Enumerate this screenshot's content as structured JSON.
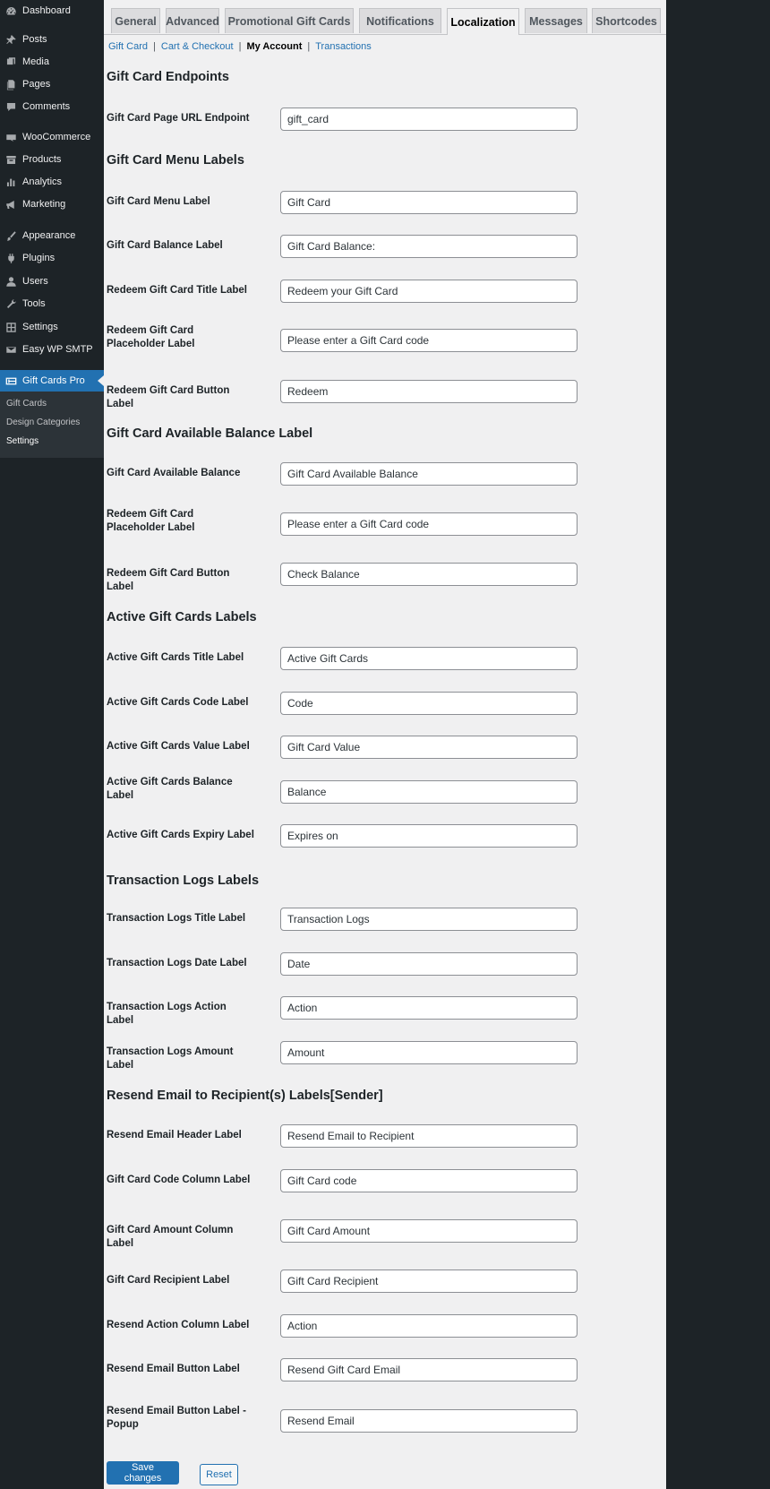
{
  "sidebar": {
    "items": [
      {
        "label": "Dashboard",
        "icon": "dashboard-icon"
      },
      {
        "label": "Posts",
        "icon": "pin-icon"
      },
      {
        "label": "Media",
        "icon": "media-icon"
      },
      {
        "label": "Pages",
        "icon": "pages-icon"
      },
      {
        "label": "Comments",
        "icon": "comment-icon"
      },
      {
        "label": "WooCommerce",
        "icon": "woo-icon"
      },
      {
        "label": "Products",
        "icon": "archive-icon"
      },
      {
        "label": "Analytics",
        "icon": "bar-chart-icon"
      },
      {
        "label": "Marketing",
        "icon": "megaphone-icon"
      },
      {
        "label": "Appearance",
        "icon": "brush-icon"
      },
      {
        "label": "Plugins",
        "icon": "plug-icon"
      },
      {
        "label": "Users",
        "icon": "user-icon"
      },
      {
        "label": "Tools",
        "icon": "wrench-icon"
      },
      {
        "label": "Settings",
        "icon": "settings-icon"
      },
      {
        "label": "Easy WP SMTP",
        "icon": "mail-icon"
      },
      {
        "label": "Gift Cards Pro",
        "icon": "gift-card-icon"
      }
    ],
    "submenu": [
      "Gift Cards",
      "Design Categories",
      "Settings"
    ]
  },
  "tabs": [
    "General",
    "Advanced",
    "Promotional Gift Cards",
    "Notifications",
    "Localization",
    "Messages",
    "Shortcodes"
  ],
  "active_tab": "Localization",
  "subnav": [
    "Gift Card",
    "Cart & Checkout",
    "My Account",
    "Transactions"
  ],
  "subnav_current": "My Account",
  "sections": [
    {
      "title": "Gift Card Endpoints",
      "fields": [
        {
          "label": "Gift Card Page URL Endpoint",
          "value": "gift_card"
        }
      ]
    },
    {
      "title": "Gift Card Menu Labels",
      "fields": [
        {
          "label": "Gift Card Menu Label",
          "value": "Gift Card"
        },
        {
          "label": "Gift Card Balance Label",
          "value": "Gift Card Balance:"
        },
        {
          "label": "Redeem Gift Card Title Label",
          "value": "Redeem your Gift Card"
        },
        {
          "label": "Redeem Gift Card Placeholder Label",
          "value": "Please enter a Gift Card code"
        },
        {
          "label": "Redeem Gift Card Button Label",
          "value": "Redeem"
        }
      ]
    },
    {
      "title": "Gift Card Available Balance Label",
      "fields": [
        {
          "label": "Gift Card Available Balance",
          "value": "Gift Card Available Balance"
        },
        {
          "label": "Redeem Gift Card Placeholder Label",
          "value": "Please enter a Gift Card code"
        },
        {
          "label": "Redeem Gift Card Button Label",
          "value": "Check Balance"
        }
      ]
    },
    {
      "title": "Active Gift Cards Labels",
      "fields": [
        {
          "label": "Active Gift Cards Title Label",
          "value": "Active Gift Cards"
        },
        {
          "label": "Active Gift Cards Code Label",
          "value": "Code"
        },
        {
          "label": "Active Gift Cards Value Label",
          "value": "Gift Card Value"
        },
        {
          "label": "Active Gift Cards Balance Label",
          "value": "Balance"
        },
        {
          "label": "Active Gift Cards Expiry Label",
          "value": "Expires on"
        }
      ]
    },
    {
      "title": "Transaction Logs Labels",
      "fields": [
        {
          "label": "Transaction Logs Title Label",
          "value": "Transaction Logs"
        },
        {
          "label": "Transaction Logs Date Label",
          "value": "Date"
        },
        {
          "label": "Transaction Logs Action Label",
          "value": "Action"
        },
        {
          "label": "Transaction Logs Amount Label",
          "value": "Amount"
        }
      ]
    },
    {
      "title": "Resend Email to Recipient(s) Labels[Sender]",
      "fields": [
        {
          "label": "Resend Email Header Label",
          "value": "Resend Email to Recipient"
        },
        {
          "label": "Gift Card Code Column Label",
          "value": "Gift Card code"
        },
        {
          "label": "Gift Card Amount Column Label",
          "value": "Gift Card Amount"
        },
        {
          "label": "Gift Card Recipient Label",
          "value": "Gift Card Recipient"
        },
        {
          "label": "Resend Action Column Label",
          "value": "Action"
        },
        {
          "label": "Resend Email Button Label",
          "value": "Resend Gift Card Email"
        },
        {
          "label": "Resend Email Button Label - Popup",
          "value": "Resend Email"
        }
      ]
    }
  ],
  "buttons": {
    "save": "Save changes",
    "reset": "Reset"
  },
  "colors": {
    "accent": "#2271b1",
    "sidebar": "#1d2327",
    "content_bg": "#f0f0f1"
  }
}
